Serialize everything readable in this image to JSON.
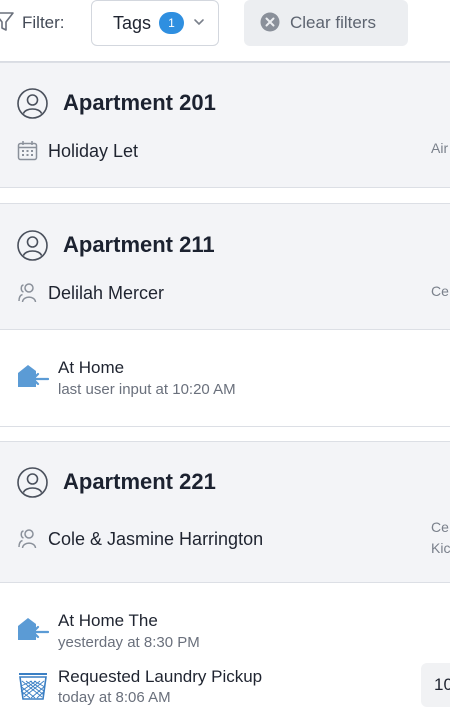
{
  "filter_bar": {
    "label": "Filter:",
    "tags_label": "Tags",
    "tags_count": "1",
    "clear_label": "Clear filters"
  },
  "apartments": [
    {
      "title": "Apartment 201",
      "row_icon": "calendar-icon",
      "row_label": "Holiday Let",
      "side_text": [
        "Air"
      ]
    },
    {
      "title": "Apartment 211",
      "row_icon": "people-icon",
      "row_label": "Delilah Mercer",
      "side_text": [
        "Ce"
      ]
    },
    {
      "title": "Apartment 221",
      "row_icon": "people-icon",
      "row_label": "Cole & Jasmine Harrington",
      "side_text": [
        "Ce",
        "Kic"
      ]
    }
  ],
  "events": [
    {
      "icon": "home-arrival-icon",
      "title": "At Home",
      "subtitle": "last user input at 10:20 AM"
    },
    {
      "icon": "home-arrival-icon",
      "title": "At Home The",
      "subtitle": "yesterday at 8:30 PM"
    },
    {
      "icon": "laundry-basket-icon",
      "title": "Requested Laundry Pickup",
      "subtitle": "today at 8:06 AM",
      "chip": "10"
    }
  ],
  "colors": {
    "accent": "#2f8fe0",
    "section_bg": "#f3f4f7",
    "icon_blue": "#5b9bd5"
  }
}
